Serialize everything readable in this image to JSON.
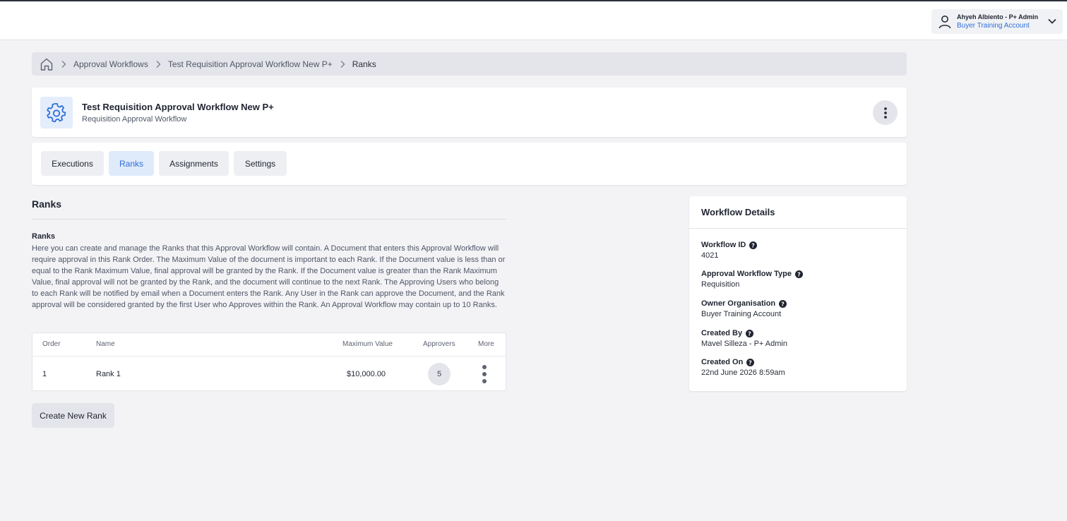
{
  "user": {
    "name": "Ahyeh Albiento - P+ Admin",
    "account": "Buyer Training Account"
  },
  "breadcrumb": {
    "items": [
      "Approval Workflows",
      "Test Requisition Approval Workflow New P+"
    ],
    "current": "Ranks"
  },
  "header": {
    "title": "Test Requisition Approval Workflow New P+",
    "subtitle": "Requisition Approval Workflow"
  },
  "tabs": [
    {
      "label": "Executions",
      "active": false
    },
    {
      "label": "Ranks",
      "active": true
    },
    {
      "label": "Assignments",
      "active": false
    },
    {
      "label": "Settings",
      "active": false
    }
  ],
  "ranks_section": {
    "title": "Ranks",
    "subtitle": "Ranks",
    "description": "Here you can create and manage the Ranks that this Approval Workflow will contain. A Document that enters this Approval Workflow will require approval in this Rank Order. The Maximum Value of the document is important to each Rank. If the Document value is less than or equal to the Rank Maximum Value, final approval will be granted by the Rank. If the Document value is greater than the Rank Maximum Value, final approval will not be granted by the Rank, and the document will continue to the next Rank. The Approving Users who belong to each Rank will be notified by email when a Document enters the Rank. Any User in the Rank can approve the Document, and the Rank approval will be considered granted by the first User who Approves within the Rank. An Approval Workflow may contain up to 10 Ranks."
  },
  "table": {
    "columns": {
      "order": "Order",
      "name": "Name",
      "max_value": "Maximum Value",
      "approvers": "Approvers",
      "more": "More"
    },
    "rows": [
      {
        "order": "1",
        "name": "Rank 1",
        "max_value": "$10,000.00",
        "approvers": "5"
      }
    ]
  },
  "create_button": "Create New Rank",
  "details": {
    "title": "Workflow Details",
    "fields": [
      {
        "label": "Workflow ID",
        "value": "4021"
      },
      {
        "label": "Approval Workflow Type",
        "value": "Requisition"
      },
      {
        "label": "Owner Organisation",
        "value": "Buyer Training Account"
      },
      {
        "label": "Created By",
        "value": "Mavel Silleza - P+ Admin"
      },
      {
        "label": "Created On",
        "value": "22nd June 2026 8:59am"
      }
    ]
  },
  "colors": {
    "accent": "#2f6fd6",
    "active_tab_bg": "#dfeafb",
    "page_bg": "#f3f3f6"
  }
}
